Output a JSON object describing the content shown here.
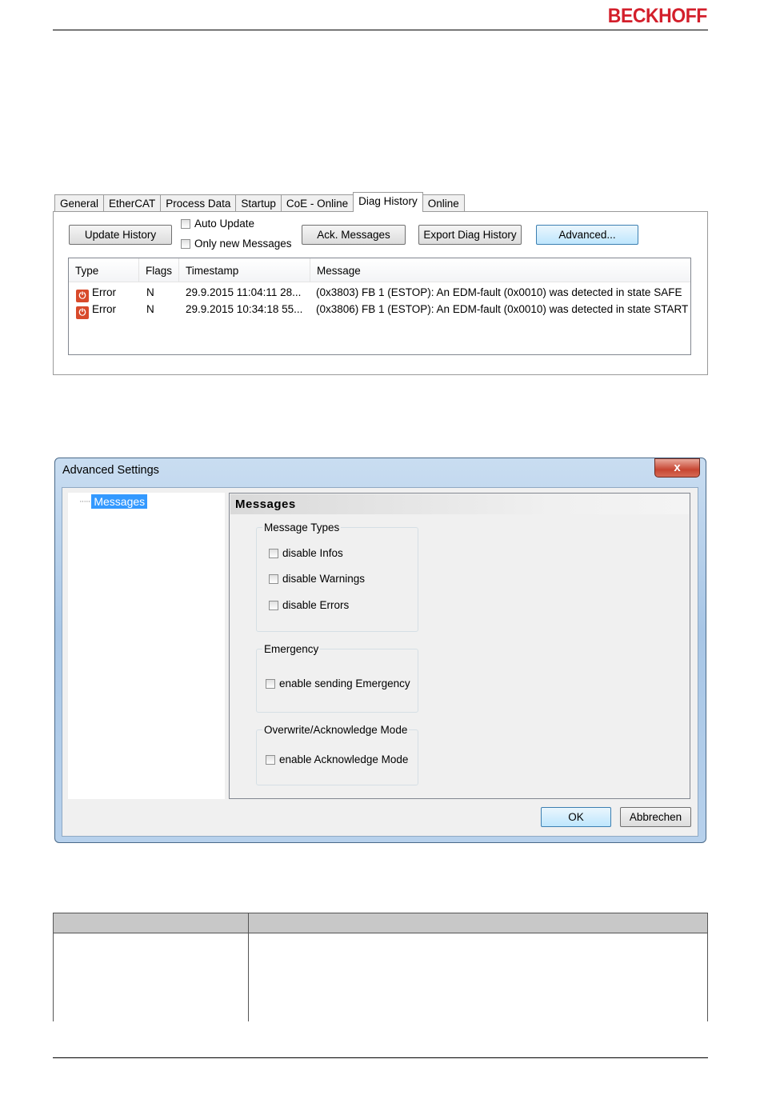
{
  "header": {
    "logo": "BECKHOFF"
  },
  "diag": {
    "tabs": [
      "General",
      "EtherCAT",
      "Process Data",
      "Startup",
      "CoE - Online",
      "Diag History",
      "Online"
    ],
    "active_tab": "Diag History",
    "buttons": {
      "update_history": "Update History",
      "ack_messages": "Ack. Messages",
      "export_diag": "Export Diag History",
      "advanced": "Advanced..."
    },
    "checkboxes": {
      "auto_update": "Auto Update",
      "only_new": "Only new Messages"
    },
    "columns": [
      "Type",
      "Flags",
      "Timestamp",
      "Message"
    ],
    "rows": [
      {
        "type": "Error",
        "flags": "N",
        "timestamp": "29.9.2015 11:04:11 28...",
        "message": "(0x3803) FB 1 (ESTOP): An EDM-fault (0x0010) was detected in state SAFE"
      },
      {
        "type": "Error",
        "flags": "N",
        "timestamp": "29.9.2015 10:34:18 55...",
        "message": "(0x3806) FB 1 (ESTOP): An EDM-fault (0x0010) was detected in state START"
      }
    ]
  },
  "dialog": {
    "title": "Advanced Settings",
    "close": "x",
    "tree_item": "Messages",
    "pane_title": "Messages",
    "groups": {
      "message_types": {
        "label": "Message Types",
        "items": [
          "disable Infos",
          "disable Warnings",
          "disable Errors"
        ]
      },
      "emergency": {
        "label": "Emergency",
        "items": [
          "enable sending Emergency"
        ]
      },
      "overwrite": {
        "label": "Overwrite/Acknowledge Mode",
        "items": [
          "enable Acknowledge Mode"
        ]
      }
    },
    "ok": "OK",
    "cancel": "Abbrechen"
  },
  "colors": {
    "logo_red": "#d31f2b",
    "selection": "#3399ff",
    "error_icon": "#d84a2b"
  }
}
